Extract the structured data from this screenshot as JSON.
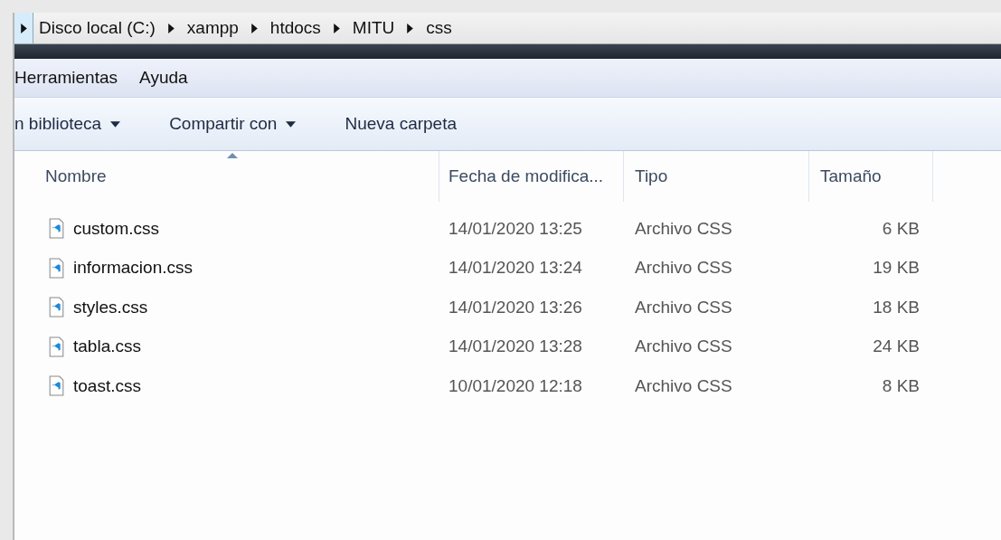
{
  "address_bar": {
    "path": [
      "Disco local (C:)",
      "xampp",
      "htdocs",
      "MITU",
      "css"
    ]
  },
  "menu_bar": [
    "Herramientas",
    "Ayuda"
  ],
  "toolbar": [
    {
      "label": "n biblioteca",
      "dropdown": true
    },
    {
      "label": "Compartir con",
      "dropdown": true
    },
    {
      "label": "Nueva carpeta",
      "dropdown": false
    }
  ],
  "table": {
    "columns": [
      {
        "label": "Nombre",
        "sorted": true
      },
      {
        "label": "Fecha de modifica...",
        "sorted": false
      },
      {
        "label": "Tipo",
        "sorted": false
      },
      {
        "label": "Tamaño",
        "sorted": false
      }
    ],
    "rows": [
      {
        "name": "custom.css",
        "date": "14/01/2020 13:25",
        "type": "Archivo CSS",
        "size": "6 KB"
      },
      {
        "name": "informacion.css",
        "date": "14/01/2020 13:24",
        "type": "Archivo CSS",
        "size": "19 KB"
      },
      {
        "name": "styles.css",
        "date": "14/01/2020 13:26",
        "type": "Archivo CSS",
        "size": "18 KB"
      },
      {
        "name": "tabla.css",
        "date": "14/01/2020 13:28",
        "type": "Archivo CSS",
        "size": "24 KB"
      },
      {
        "name": "toast.css",
        "date": "10/01/2020 12:18",
        "type": "Archivo CSS",
        "size": "8 KB"
      }
    ]
  }
}
